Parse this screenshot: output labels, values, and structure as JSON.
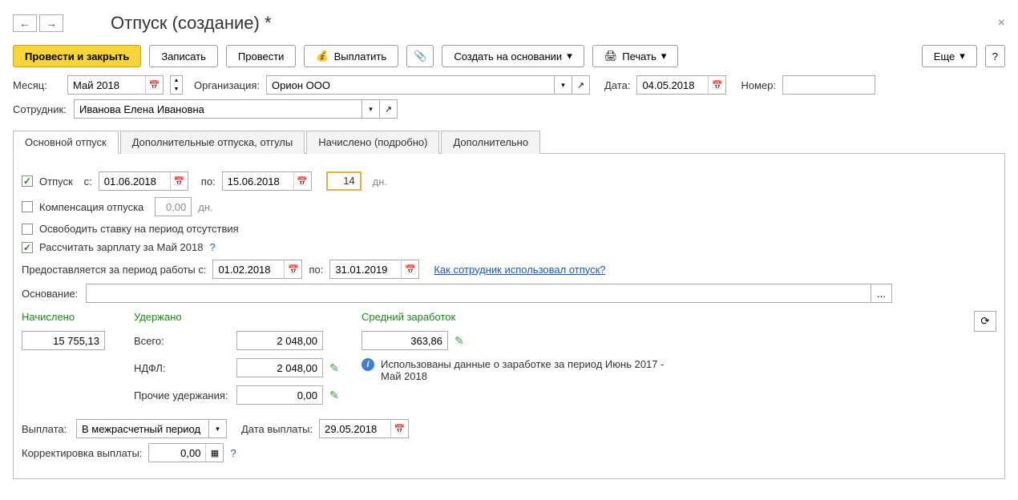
{
  "header": {
    "title": "Отпуск (создание) *"
  },
  "toolbar": {
    "main_btn": "Провести и закрыть",
    "save_btn": "Записать",
    "post_btn": "Провести",
    "pay_btn": "Выплатить",
    "create_based": "Создать на основании",
    "print_btn": "Печать",
    "more_btn": "Еще",
    "help_btn": "?"
  },
  "form": {
    "month_lbl": "Месяц:",
    "month_val": "Май 2018",
    "org_lbl": "Организация:",
    "org_val": "Орион ООО",
    "date_lbl": "Дата:",
    "date_val": "04.05.2018",
    "number_lbl": "Номер:",
    "number_val": "",
    "employee_lbl": "Сотрудник:",
    "employee_val": "Иванова Елена Ивановна"
  },
  "tabs": [
    "Основной отпуск",
    "Дополнительные отпуска, отгулы",
    "Начислено (подробно)",
    "Дополнительно"
  ],
  "vac": {
    "vac_lbl": "Отпуск",
    "from_lbl": "с:",
    "from_val": "01.06.2018",
    "to_lbl": "по:",
    "to_val": "15.06.2018",
    "days_val": "14",
    "days_lbl": "дн.",
    "comp_lbl": "Компенсация отпуска",
    "comp_val": "0,00",
    "comp_dn": "дн.",
    "free_lbl": "Освободить ставку на период отсутствия",
    "calc_lbl": "Рассчитать зарплату за Май 2018",
    "period_lbl": "Предоставляется за период работы с:",
    "period_from": "01.02.2018",
    "period_to_lbl": "по:",
    "period_to": "31.01.2019",
    "used_link": "Как сотрудник использовал отпуск?",
    "basis_lbl": "Основание:",
    "basis_val": ""
  },
  "calc": {
    "accrued_lbl": "Начислено",
    "accrued_val": "15 755,13",
    "withheld_lbl": "Удержано",
    "total_lbl": "Всего:",
    "total_val": "2 048,00",
    "ndfl_lbl": "НДФЛ:",
    "ndfl_val": "2 048,00",
    "other_lbl": "Прочие удержания:",
    "other_val": "0,00",
    "avg_lbl": "Средний заработок",
    "avg_val": "363,86",
    "info_txt": "Использованы данные о заработке за период Июнь 2017 - Май 2018"
  },
  "payment": {
    "pay_lbl": "Выплата:",
    "pay_val": "В межрасчетный период",
    "pay_date_lbl": "Дата выплаты:",
    "pay_date_val": "29.05.2018",
    "corr_lbl": "Корректировка выплаты:",
    "corr_val": "0,00"
  }
}
